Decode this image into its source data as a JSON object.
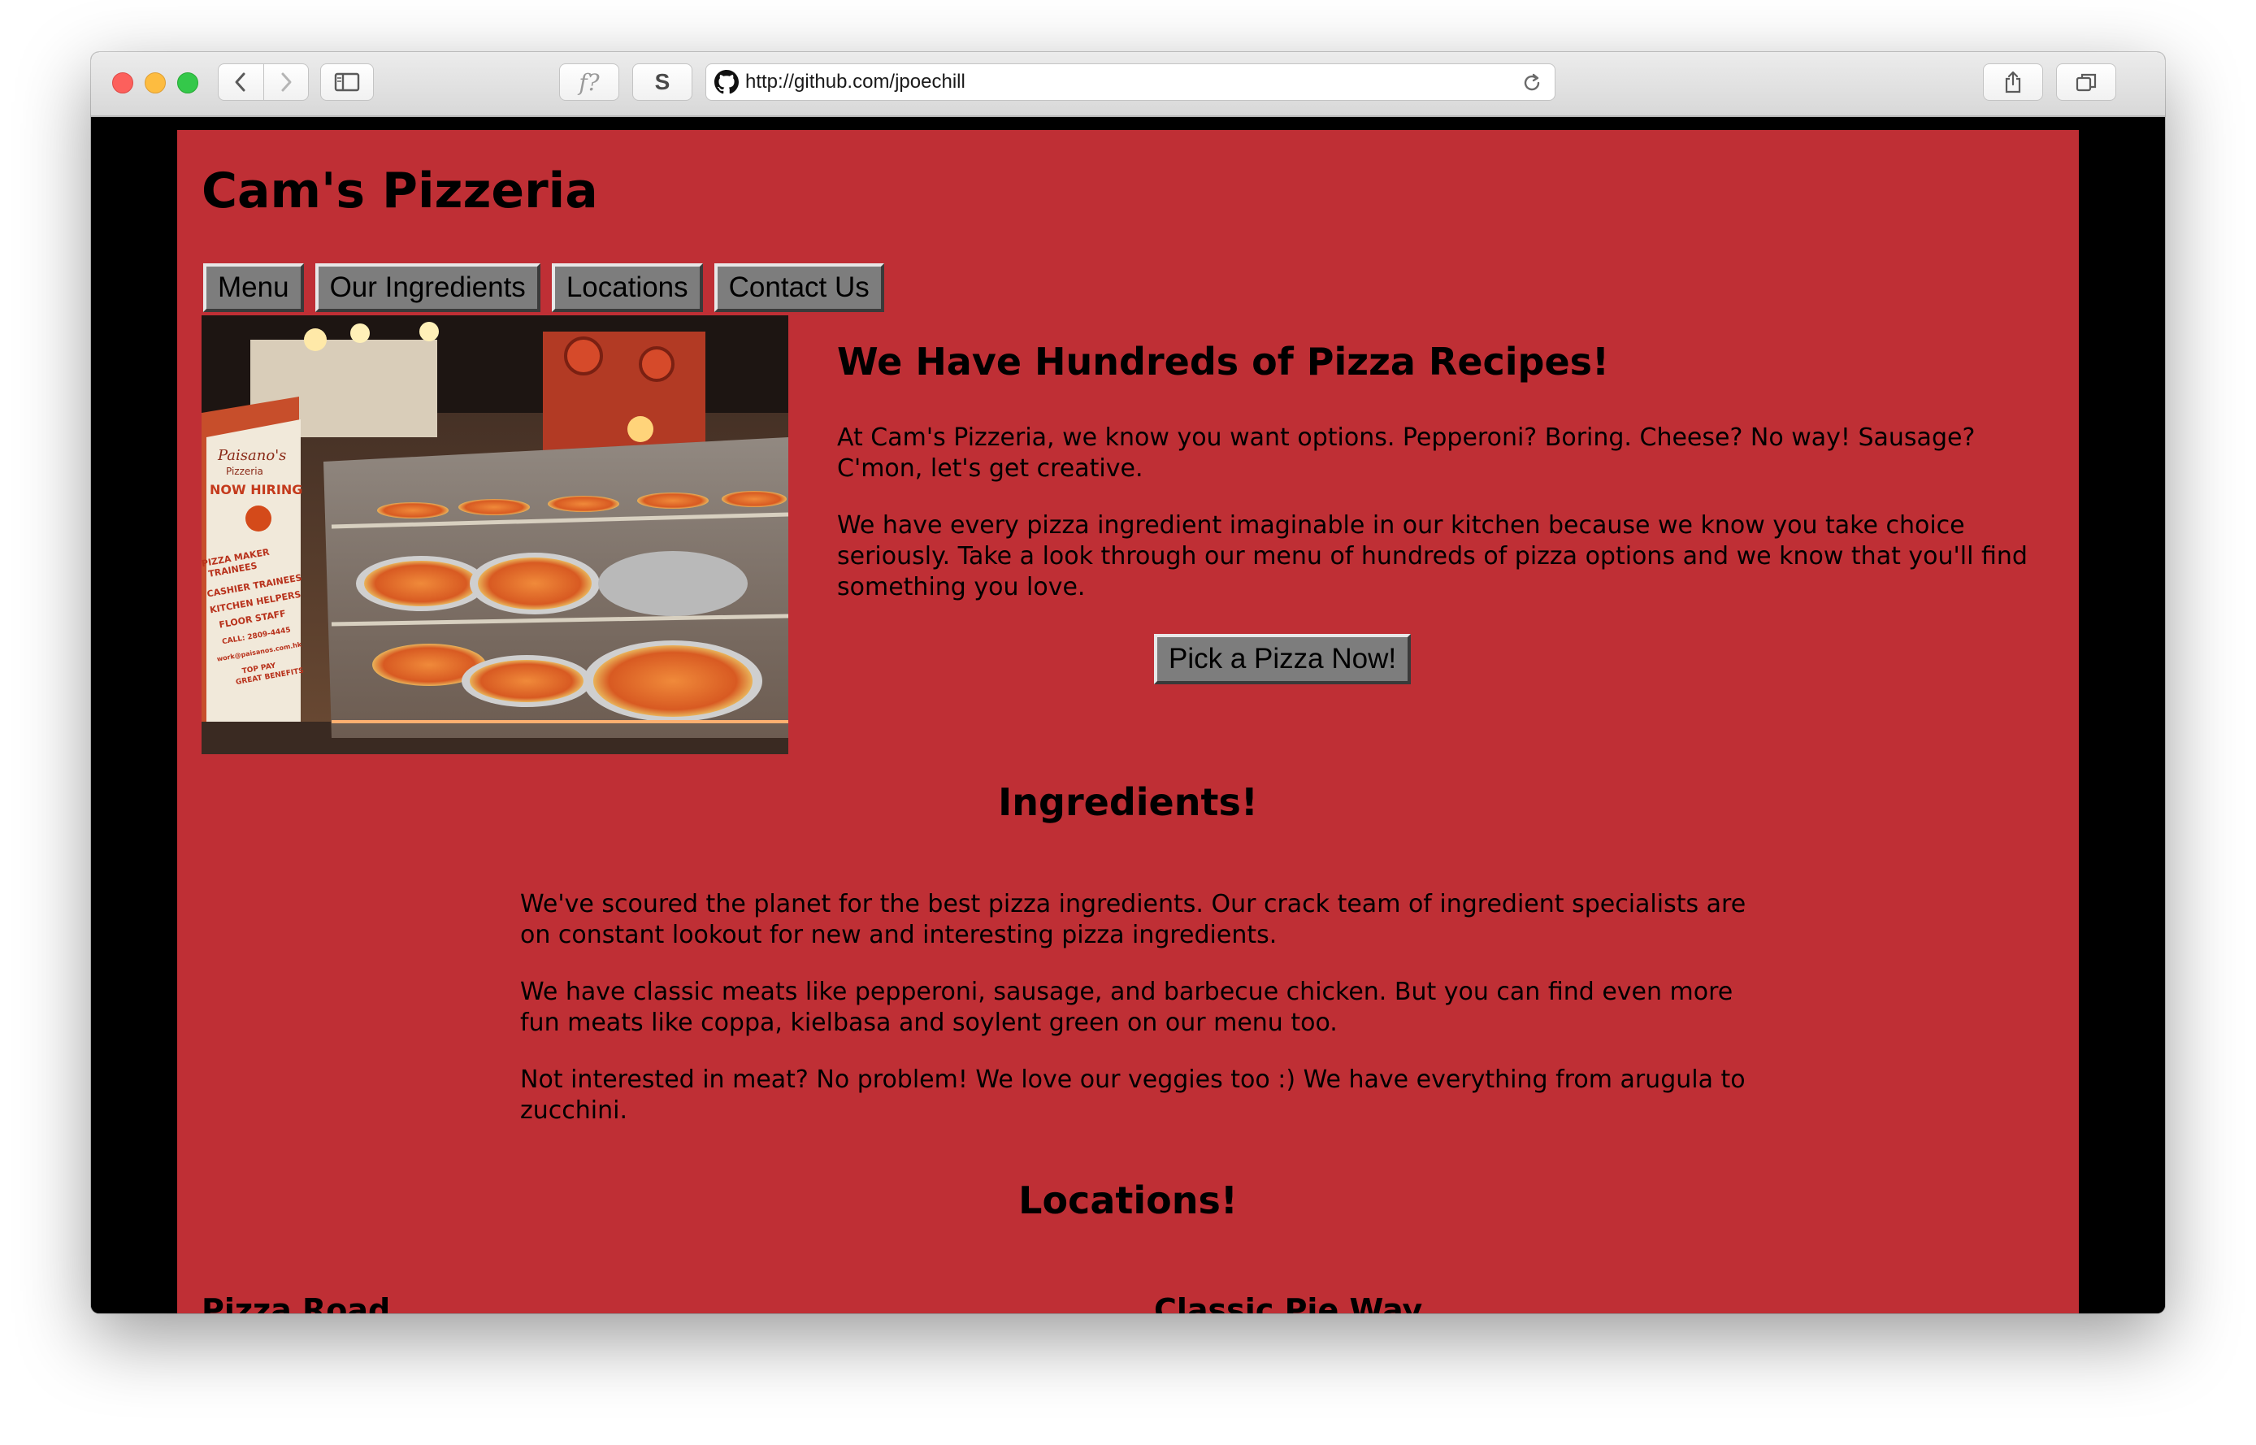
{
  "browser": {
    "url": "http://github.com/jpoechill",
    "readability_button": "f?",
    "extension_button": "S",
    "new_tab": "+"
  },
  "site": {
    "title": "Cam's Pizzeria",
    "nav": [
      "Menu",
      "Our Ingredients",
      "Locations",
      "Contact Us"
    ]
  },
  "hero": {
    "image_alt": "Paisano's Pizzeria display counter",
    "image_text": {
      "brand": "Paisano's",
      "brand_sub": "Pizzeria",
      "banner_heading": "NOW HIRING",
      "banner_lines": [
        "PIZZA MAKER",
        "TRAINEES",
        "CASHIER TRAINEES",
        "KITCHEN HELPERS",
        "FLOOR STAFF",
        "CALL: 2809-4445",
        "work@paisanos.com.hk",
        "TOP PAY",
        "GREAT BENEFITS"
      ]
    },
    "heading": "We Have Hundreds of Pizza Recipes!",
    "paragraphs": [
      "At Cam's Pizzeria, we know you want options. Pepperoni? Boring. Cheese? No way! Sausage? C'mon, let's get creative.",
      "We have every pizza ingredient imaginable in our kitchen because we know you take choice seriously. Take a look through our menu of hundreds of pizza options and we know that you'll find something you love."
    ],
    "cta": "Pick a Pizza Now!"
  },
  "ingredients": {
    "heading": "Ingredients!",
    "paragraphs": [
      "We've scoured the planet for the best pizza ingredients. Our crack team of ingredient specialists are on constant lookout for new and interesting pizza ingredients.",
      "We have classic meats like pepperoni, sausage, and barbecue chicken. But you can find even more fun meats like coppa, kielbasa and soylent green on our menu too.",
      "Not interested in meat? No problem! We love our veggies too :) We have everything from arugula to zucchini."
    ]
  },
  "locations": {
    "heading": "Locations!",
    "items": [
      "Pizza Road",
      "Classic Pie Way"
    ]
  },
  "colors": {
    "page_bg": "#bf2f35",
    "button_bg": "#7d7d7d",
    "viewport_bg": "#000000"
  }
}
